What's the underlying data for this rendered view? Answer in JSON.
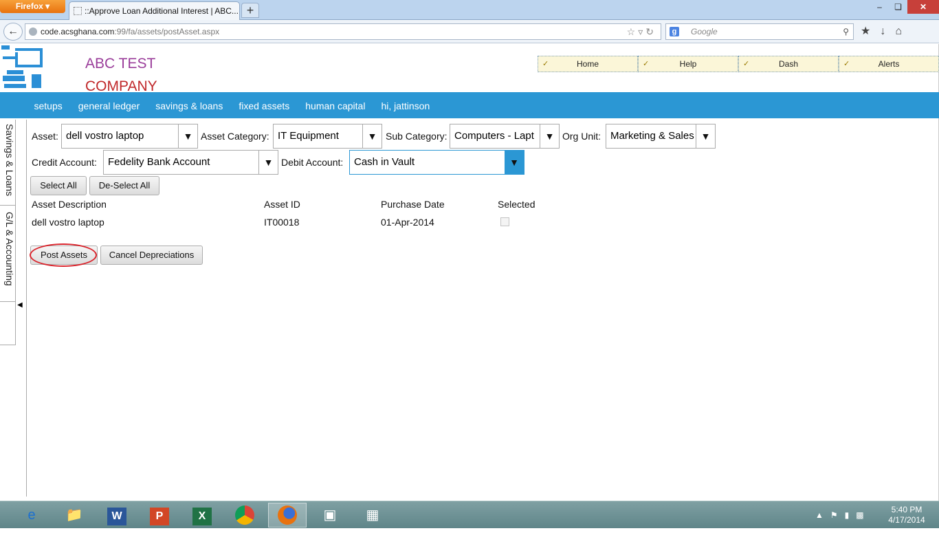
{
  "browser": {
    "menu_button": "Firefox ▾",
    "tab_title": "::Approve Loan Additional Interest | ABC...",
    "new_tab": "+",
    "window_controls": [
      "–",
      "❏",
      "✕"
    ],
    "url_host": "code.acsghana.com",
    "url_rest": ":99/fa/assets/postAsset.aspx",
    "search_placeholder": "Google",
    "search_engine_icon": "g"
  },
  "header": {
    "company_line1": "ABC TEST",
    "company_line2": "COMPANY",
    "top_menu": [
      {
        "label": "Home"
      },
      {
        "label": "Help"
      },
      {
        "label": "Dash"
      },
      {
        "label": "Alerts"
      }
    ]
  },
  "nav": {
    "items": [
      "setups",
      "general ledger",
      "savings & loans",
      "fixed assets",
      "human capital",
      "hi, jattinson"
    ]
  },
  "sidebar": {
    "tabs": [
      "Savings & Loans",
      "G/L & Accounting"
    ]
  },
  "form": {
    "asset_label": "Asset:",
    "asset_value": "dell vostro laptop",
    "asset_category_label": "Asset Category:",
    "asset_category_value": "IT Equipment",
    "sub_category_label": "Sub Category:",
    "sub_category_value": "Computers - Lapt",
    "org_unit_label": "Org Unit:",
    "org_unit_value": "Marketing & Sales",
    "credit_account_label": "Credit Account:",
    "credit_account_value": "Fedelity Bank Account",
    "debit_account_label": "Debit Account:",
    "debit_account_value": "Cash in Vault",
    "select_all": "Select All",
    "deselect_all": "De-Select All"
  },
  "table": {
    "headers": [
      "Asset Description",
      "Asset ID",
      "Purchase Date",
      "Selected"
    ],
    "rows": [
      {
        "description": "dell vostro laptop",
        "asset_id": "IT00018",
        "purchase_date": "01-Apr-2014",
        "selected": false
      }
    ]
  },
  "actions": {
    "post_assets": "Post Assets",
    "cancel_depreciations": "Cancel Depreciations"
  },
  "taskbar": {
    "time": "5:40 PM",
    "date": "4/17/2014"
  },
  "colors": {
    "nav_blue": "#2b97d4",
    "company_purple": "#9a3d9a",
    "company_red": "#c0282a",
    "highlight_ring": "#d9232b"
  }
}
